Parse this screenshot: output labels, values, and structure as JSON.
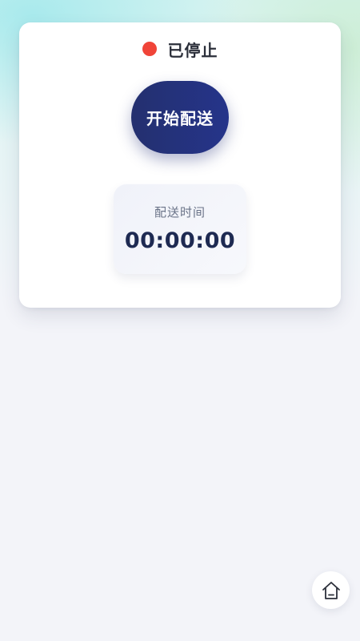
{
  "status": {
    "text": "已停止",
    "dot_color": "#f04438"
  },
  "action": {
    "start_label": "开始配送"
  },
  "timer": {
    "label": "配送时间",
    "value": "00:00:00"
  },
  "nav": {
    "home_icon": "home-icon"
  },
  "colors": {
    "primary": "#25348a",
    "timer_text": "#1e2a52"
  }
}
